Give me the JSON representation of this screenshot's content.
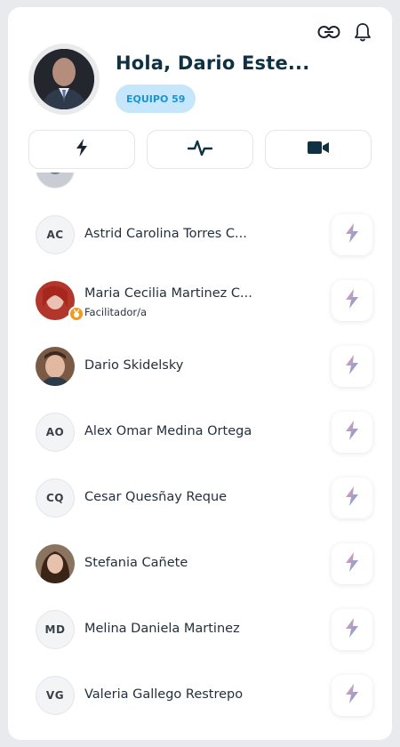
{
  "header": {
    "greeting": "Hola, Dario Este...",
    "team_badge": "EQUIPO 59"
  },
  "tabs": [
    {
      "icon": "bolt-icon"
    },
    {
      "icon": "activity-icon"
    },
    {
      "icon": "video-camera-icon"
    }
  ],
  "members": [
    {
      "initials": "AC",
      "name": "Astrid Carolina Torres C...",
      "role": ""
    },
    {
      "initials": "",
      "name": "Maria Cecilia Martinez C...",
      "role": "Facilitador/a"
    },
    {
      "initials": "",
      "name": "Dario Skidelsky",
      "role": ""
    },
    {
      "initials": "AO",
      "name": "Alex Omar Medina Ortega",
      "role": ""
    },
    {
      "initials": "CQ",
      "name": "Cesar Quesñay Reque",
      "role": ""
    },
    {
      "initials": "",
      "name": "Stefania Cañete",
      "role": ""
    },
    {
      "initials": "MD",
      "name": "Melina Daniela Martinez",
      "role": ""
    },
    {
      "initials": "VG",
      "name": "Valeria Gallego Restrepo",
      "role": ""
    }
  ],
  "colors": {
    "brand_dark": "#0f3142",
    "badge_bg": "#c6e7fb",
    "badge_text": "#1a94d2",
    "medal": "#f29a1f"
  }
}
